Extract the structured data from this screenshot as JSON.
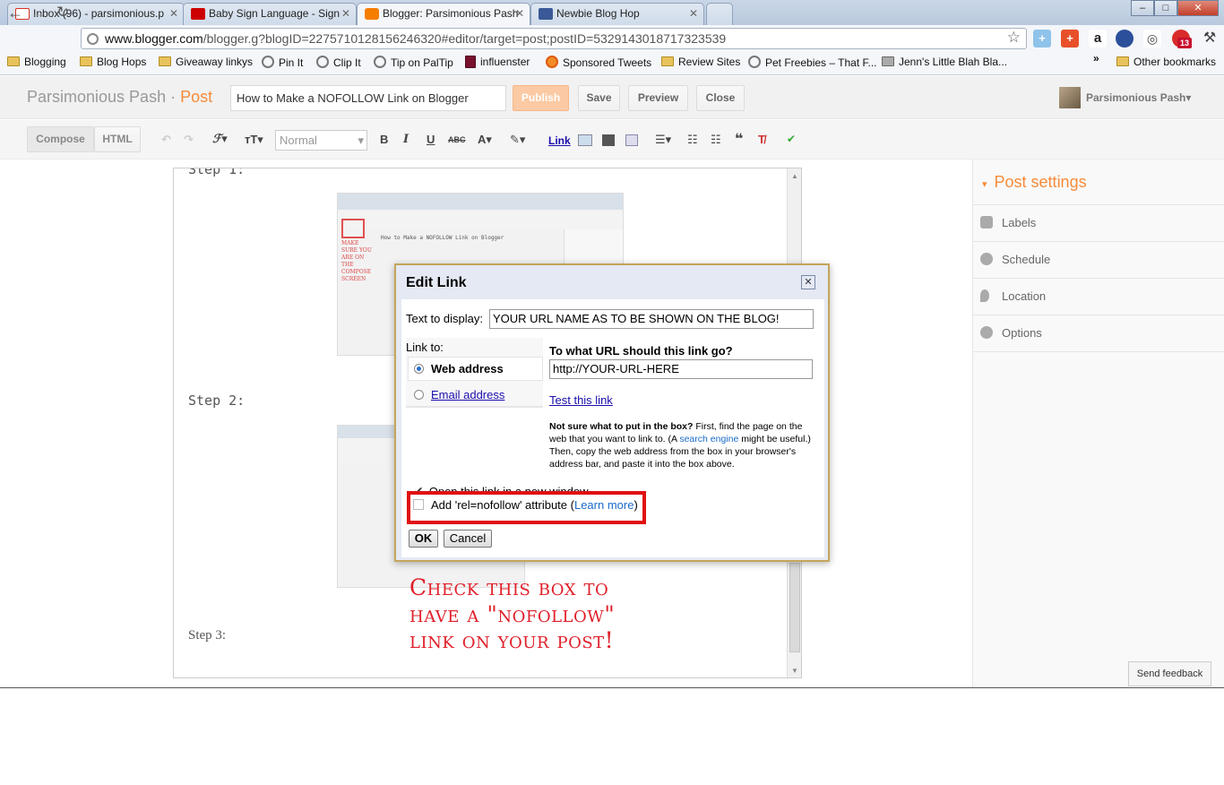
{
  "browser": {
    "tabs": [
      {
        "title": "Inbox (96) - parsimonious.p",
        "fav_color": "#d93025"
      },
      {
        "title": "Baby Sign Language - Sign",
        "fav_color": "#cc0000"
      },
      {
        "title": "Blogger: Parsimonious Pash",
        "fav_color": "#f57d00"
      },
      {
        "title": "Newbie Blog Hop",
        "fav_color": "#3b5998"
      }
    ],
    "url_host": "www.blogger.com",
    "url_path": "/blogger.g?blogID=2275710128156246320#editor/target=post;postID=5329143018717323539",
    "ext_badge": "13",
    "bookmarks": [
      {
        "label": "Blogging",
        "icon": "folder-icon"
      },
      {
        "label": "Blog Hops",
        "icon": "folder-icon"
      },
      {
        "label": "Giveaway linkys",
        "icon": "folder-icon"
      },
      {
        "label": "Pin It",
        "icon": "globe-icon"
      },
      {
        "label": "Clip It",
        "icon": "globe-icon"
      },
      {
        "label": "Tip on PalTip",
        "icon": "globe-icon"
      },
      {
        "label": "influenster",
        "icon": "site-icon"
      },
      {
        "label": "Sponsored Tweets",
        "icon": "site-icon"
      },
      {
        "label": "Review Sites",
        "icon": "folder-icon"
      },
      {
        "label": "Pet Freebies – That F...",
        "icon": "globe-icon"
      },
      {
        "label": "Jenn's Little Blah Bla...",
        "icon": "site-icon"
      }
    ],
    "bookmarks_more": "»",
    "other_bookmarks": "Other bookmarks"
  },
  "blogger": {
    "blog_name": "Parsimonious Pash",
    "separator": "·",
    "section": "Post",
    "post_title": "How to Make a NOFOLLOW Link on Blogger",
    "publish": "Publish",
    "save": "Save",
    "preview": "Preview",
    "close": "Close",
    "user": "Parsimonious Pash",
    "accent": "#f68b39"
  },
  "editor_toolbar": {
    "compose": "Compose",
    "html": "HTML",
    "font_size": "Normal",
    "link": "Link"
  },
  "post_body": {
    "step1": "Step 1:",
    "step2": "Step 2:",
    "step3": "Step 3:",
    "thumb_note": "MAKE SURE YOU ARE ON THE COMPOSE SCREEN",
    "thumb_title": "How to Make a NOFOLLOW Link on Blogger"
  },
  "sidebar": {
    "title": "Post settings",
    "items": [
      "Labels",
      "Schedule",
      "Location",
      "Options"
    ]
  },
  "dialog": {
    "title": "Edit Link",
    "text_to_display_label": "Text to display:",
    "text_to_display_value": "YOUR URL NAME AS TO BE SHOWN ON THE BLOG!",
    "link_to_label": "Link to:",
    "web_address": "Web address",
    "email_address": "Email address",
    "url_question": "To what URL should this link go?",
    "url_value": "http://YOUR-URL-HERE",
    "test_link": "Test this link",
    "help_bold": "Not sure what to put in the box?",
    "help_1": " First, find the page on the web that you want to link to. (A ",
    "help_link": "search engine",
    "help_2": " might be useful.) Then, copy the web address from the box in your browser's address bar, and paste it into the box above.",
    "open_new_window": "Open this link in a new window",
    "nofollow_pre": "Add 'rel=nofollow' attribute (",
    "learn_more": "Learn more",
    "nofollow_post": ")",
    "ok": "OK",
    "cancel": "Cancel"
  },
  "annotation": {
    "line1": "Check this box to",
    "line2": "have a \"nofollow\"",
    "line3": "link on your post!"
  },
  "send_feedback": "Send feedback"
}
